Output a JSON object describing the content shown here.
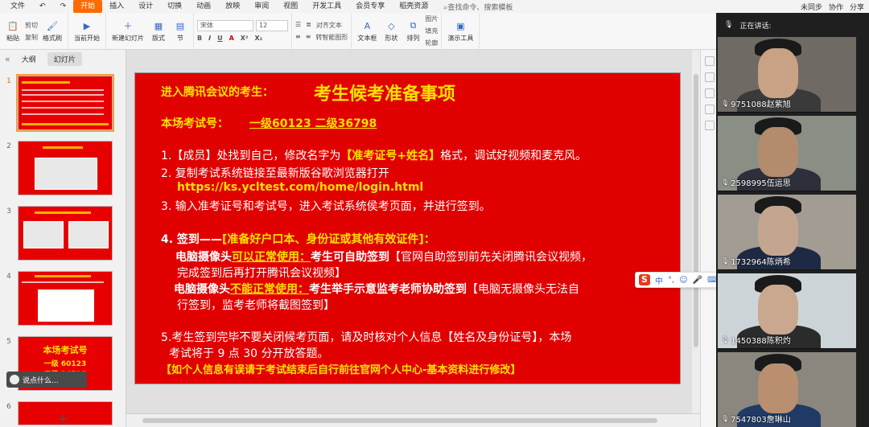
{
  "menubar": {
    "file": "文件",
    "items": [
      "开始",
      "插入",
      "设计",
      "切换",
      "动画",
      "放映",
      "审阅",
      "视图",
      "开发工具",
      "会员专享",
      "稻壳资源"
    ],
    "active_index": 0,
    "search": "查找命令、搜索模板"
  },
  "rightbar": {
    "sync": "未同步",
    "collab": "协作",
    "share": "分享"
  },
  "ribbon": {
    "paste": "粘贴",
    "cut": "剪切",
    "copy": "复制",
    "format_painter": "格式刷",
    "play_from_current": "当前开始",
    "new_slide": "新建幻灯片",
    "layout": "版式",
    "section": "节",
    "font": "宋体",
    "size": "12",
    "align_text": "对齐文本",
    "to_smartart": "转智能图形",
    "textbox": "文本框",
    "shape": "形状",
    "arrange": "排列",
    "picture": "图片",
    "fill": "填充",
    "outline": "轮廓",
    "presenter": "演示工具"
  },
  "leftpanel": {
    "tab_outline": "大纲",
    "tab_slides": "幻灯片",
    "comment": "说点什么...",
    "slide_numbers": [
      "1",
      "2",
      "3",
      "4",
      "5",
      "6"
    ],
    "thumb5_title": "本场考试号",
    "thumb5_line1": "一级 60123",
    "thumb5_line2": "二级 36798"
  },
  "slide": {
    "lead": "进入腾讯会议的考生：",
    "title": "考生候考准备事项",
    "exam_no": "本场考试号：",
    "exam_values": "一级60123   二级36798",
    "item1_a": "1.【成员】处找到自己，修改名字为",
    "item1_b": "【准考证号+姓名】",
    "item1_c": "格式，调试好视频和麦克风。",
    "item2": "2. 复制考试系统链接至最新版谷歌浏览器打开",
    "url": "https://ks.ycltest.com/home/login.html",
    "item3": "3. 输入准考证号和考试号，进入考试系统侯考页面，并进行签到。",
    "item4_a": "4. 签到——",
    "item4_b": "[准备好户口本、身份证或其他有效证件]：",
    "cam_ok_a": "电脑摄像头",
    "cam_ok_b": "可以正常使用：",
    "cam_ok_c": "考生可自助签到",
    "cam_ok_d": "【官网自助签到前先关闭腾讯会议视频，",
    "cam_ok_e": "完成签到后再打开腾讯会议视频】",
    "cam_bad_a": "电脑摄像头",
    "cam_bad_b": "不能正常使用：",
    "cam_bad_c": "考生举手示意监考老师协助签到",
    "cam_bad_d": "【电脑无摄像头无法自",
    "cam_bad_e": "行签到，监考老师将截图签到】",
    "item5_a": "5.考生签到完毕不要关闭候考页面，请及时核对个人信息【姓名及身份证号】，本场",
    "item5_b": "考试将于  9  点  30  分开放答题。",
    "note": "【如个人信息有误请于考试结束后自行前往官网个人中心-基本资料进行修改】"
  },
  "ime": {
    "logo": "S",
    "mode": "中"
  },
  "videopanel": {
    "speaking": "正在讲话:",
    "participants": [
      "9751088赵紫旭",
      "2598995伍运思",
      "1732964陈炳希",
      "1450388陈积灼",
      "7547803詹琳山"
    ]
  },
  "colors": {
    "slide_bg": "#e10000",
    "highlight": "#ffe100",
    "accent": "#ff6a00"
  }
}
